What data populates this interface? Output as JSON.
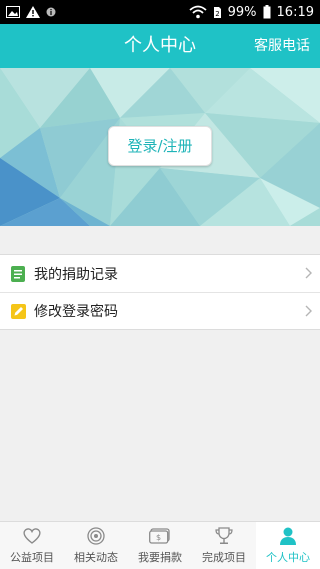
{
  "status_bar": {
    "battery": "99%",
    "time": "16:19"
  },
  "header": {
    "title": "个人中心",
    "service_link": "客服电话"
  },
  "banner": {
    "login_label": "登录/注册"
  },
  "menu": {
    "items": [
      {
        "label": "我的捐助记录",
        "icon": "document-icon",
        "icon_color": "#4caf50"
      },
      {
        "label": "修改登录密码",
        "icon": "edit-icon",
        "icon_color": "#f5c518"
      }
    ]
  },
  "tabs": [
    {
      "label": "公益项目",
      "icon": "heart-icon"
    },
    {
      "label": "相关动态",
      "icon": "target-icon"
    },
    {
      "label": "我要捐款",
      "icon": "money-icon"
    },
    {
      "label": "完成项目",
      "icon": "trophy-icon"
    },
    {
      "label": "个人中心",
      "icon": "person-icon",
      "active": true
    }
  ],
  "colors": {
    "accent": "#1fc2c6",
    "inactive_icon": "#8a8a8a"
  }
}
